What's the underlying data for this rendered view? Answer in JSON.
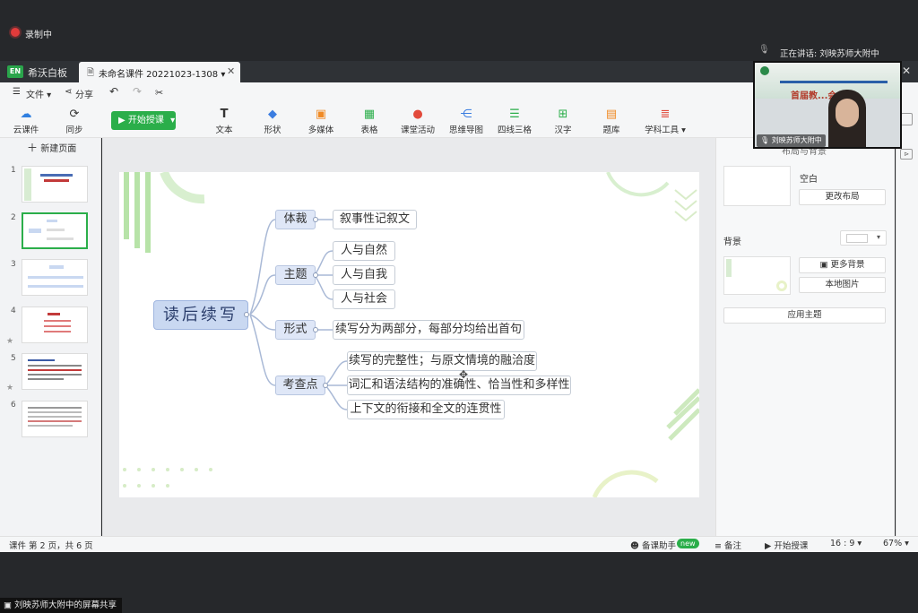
{
  "meeting": {
    "recording_label": "录制中",
    "speaking_label": "正在讲话: 刘映苏师大附中",
    "share_label": "刘映苏师大附中的屏幕共享",
    "webcam_name": "刘映苏师大附中",
    "webcam_banner": "首届教...会"
  },
  "app": {
    "name": "希沃白板",
    "tab_title": "未命名课件 20221023-1308 ▾"
  },
  "menu": {
    "file": "文件",
    "share": "分享"
  },
  "toolbar": {
    "cloud": "云课件",
    "sync": "同步",
    "start": "开始授课",
    "text": "文本",
    "shape": "形状",
    "media": "多媒体",
    "table": "表格",
    "activity": "课堂活动",
    "mindmap": "思维导图",
    "four_lines": "四线三格",
    "hanzi": "汉字",
    "question_bank": "题库",
    "subject_tools": "学科工具"
  },
  "left": {
    "new_page": "新建页面",
    "thumb_numbers": [
      "1",
      "2",
      "3",
      "4",
      "5",
      "6"
    ]
  },
  "mindmap": {
    "root": "读后续写",
    "categories": [
      "体裁",
      "主题",
      "形式",
      "考查点"
    ],
    "genre": "叙事性记叙文",
    "themes": [
      "人与自然",
      "人与自我",
      "人与社会"
    ],
    "form": "续写分为两部分，每部分均给出首句",
    "points": [
      "续写的完整性；与原文情境的融洽度",
      "词汇和语法结构的准确性、恰当性和多样性",
      "上下文的衔接和全文的连贯性"
    ]
  },
  "right": {
    "header": "布局与背景",
    "blank_label": "空白",
    "change_layout": "更改布局",
    "background_label": "背景",
    "more_bg": "更多背景",
    "local_image": "本地图片",
    "apply_theme": "应用主题"
  },
  "status": {
    "page_info": "课件 第 2 页，共 6 页",
    "assistant": "备课助手",
    "new_badge": "new",
    "notes": "备注",
    "start_teaching": "开始授课",
    "ratio": "16 : 9 ▾",
    "zoom": "67% ▾"
  },
  "colors": {
    "accent_green": "#2bae4a",
    "node_blue": "#dfe7f7",
    "line_blue": "#a9b9d6"
  }
}
